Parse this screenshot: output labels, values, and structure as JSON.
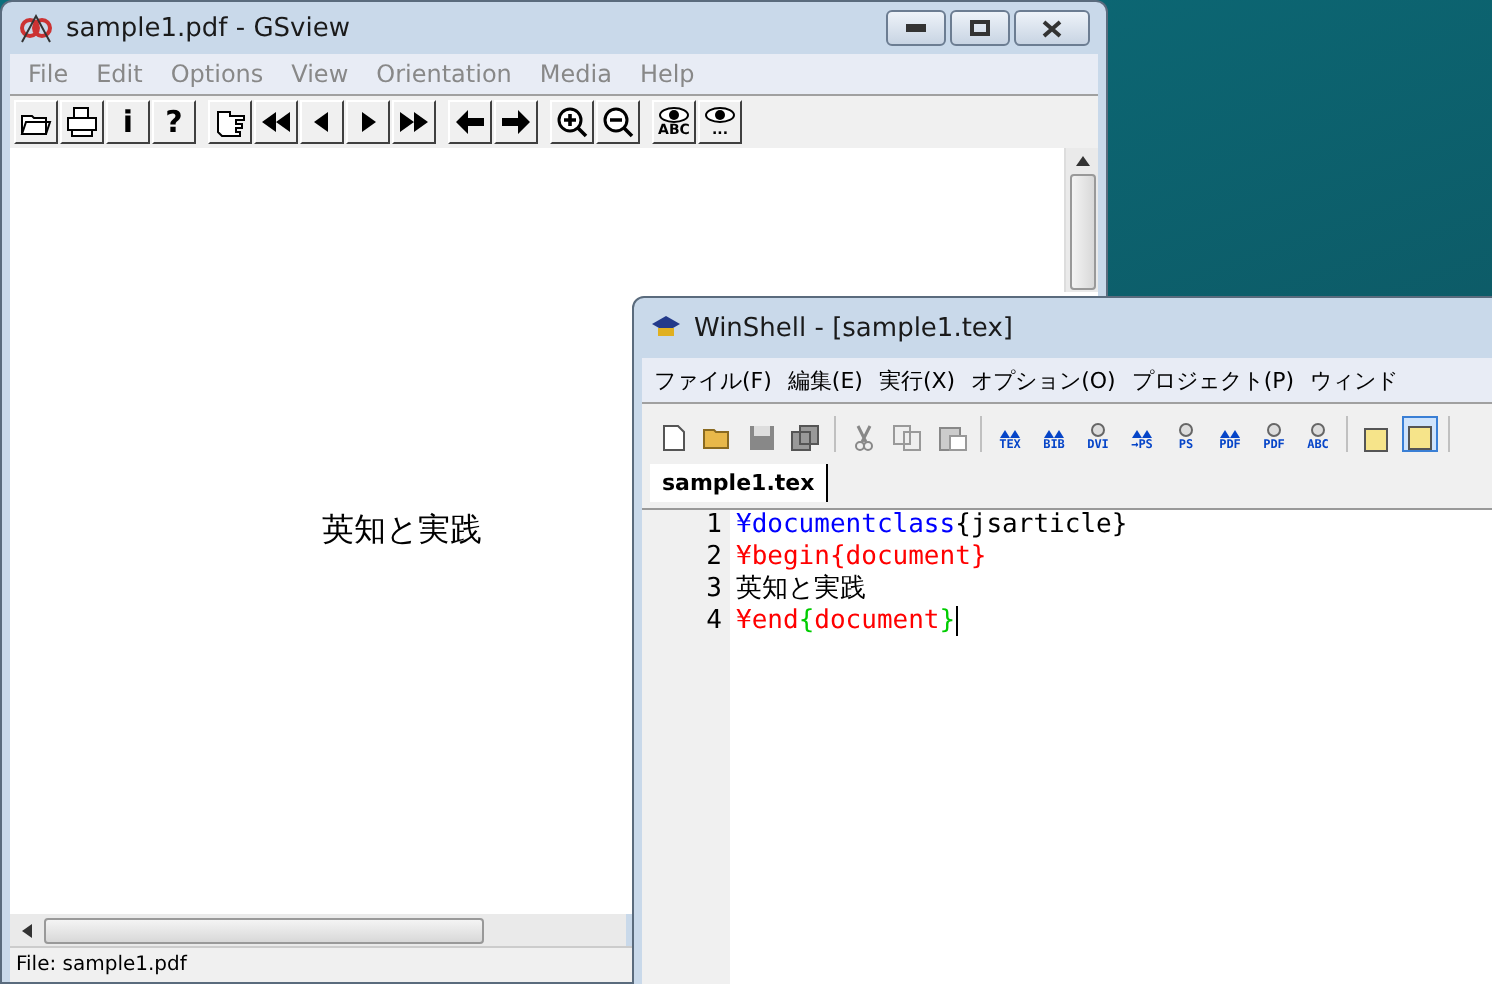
{
  "gsview": {
    "title": "sample1.pdf - GSview",
    "menu": [
      "File",
      "Edit",
      "Options",
      "View",
      "Orientation",
      "Media",
      "Help"
    ],
    "toolbar": [
      [
        {
          "kind": "open"
        },
        {
          "kind": "print"
        },
        {
          "kind": "char",
          "label": "i"
        },
        {
          "kind": "char",
          "label": "?"
        }
      ],
      [
        {
          "kind": "goto"
        },
        {
          "kind": "first"
        },
        {
          "kind": "prev"
        },
        {
          "kind": "next"
        },
        {
          "kind": "last"
        }
      ],
      [
        {
          "kind": "back"
        },
        {
          "kind": "forward"
        }
      ],
      [
        {
          "kind": "zoomin"
        },
        {
          "kind": "zoomout"
        }
      ],
      [
        {
          "kind": "eye",
          "label": "ABC"
        },
        {
          "kind": "eye",
          "label": "..."
        }
      ]
    ],
    "page_text": "英知と実践",
    "status": "File: sample1.pdf"
  },
  "winshell": {
    "title": "WinShell - [sample1.tex]",
    "menu": [
      "ファイル(F)",
      "編集(E)",
      "実行(X)",
      "オプション(O)",
      "プロジェクト(P)",
      "ウィンド"
    ],
    "toolbar": [
      [
        {
          "kind": "new"
        },
        {
          "kind": "open"
        },
        {
          "kind": "save"
        },
        {
          "kind": "saveall"
        }
      ],
      [
        {
          "kind": "cut"
        },
        {
          "kind": "copy"
        },
        {
          "kind": "paste"
        }
      ],
      [
        {
          "kind": "run",
          "label": "TEX"
        },
        {
          "kind": "run",
          "label": "BIB"
        },
        {
          "kind": "view",
          "label": "DVI"
        },
        {
          "kind": "run",
          "label": "→PS"
        },
        {
          "kind": "view",
          "label": "PS"
        },
        {
          "kind": "run",
          "label": "PDF"
        },
        {
          "kind": "view",
          "label": "PDF"
        },
        {
          "kind": "check",
          "label": "ABC"
        }
      ],
      [
        {
          "kind": "pane",
          "selected": false
        },
        {
          "kind": "pane",
          "selected": true
        }
      ]
    ],
    "tabs": [
      {
        "label": "sample1.tex",
        "selected": true
      }
    ],
    "lines": [
      {
        "number": "1",
        "parts": [
          {
            "kind": "command",
            "text": "¥documentclass"
          },
          {
            "kind": "plain",
            "text": "{jsarticle}"
          }
        ]
      },
      {
        "number": "2",
        "parts": [
          {
            "kind": "environment",
            "text": "¥begin{document}"
          }
        ]
      },
      {
        "number": "3",
        "parts": [
          {
            "kind": "plain",
            "text": "英知と実践"
          }
        ]
      },
      {
        "number": "4",
        "parts": [
          {
            "kind": "environment",
            "text": "¥end"
          },
          {
            "kind": "brace",
            "text": "{"
          },
          {
            "kind": "environment",
            "text": "document"
          },
          {
            "kind": "brace",
            "text": "}"
          }
        ]
      }
    ]
  }
}
